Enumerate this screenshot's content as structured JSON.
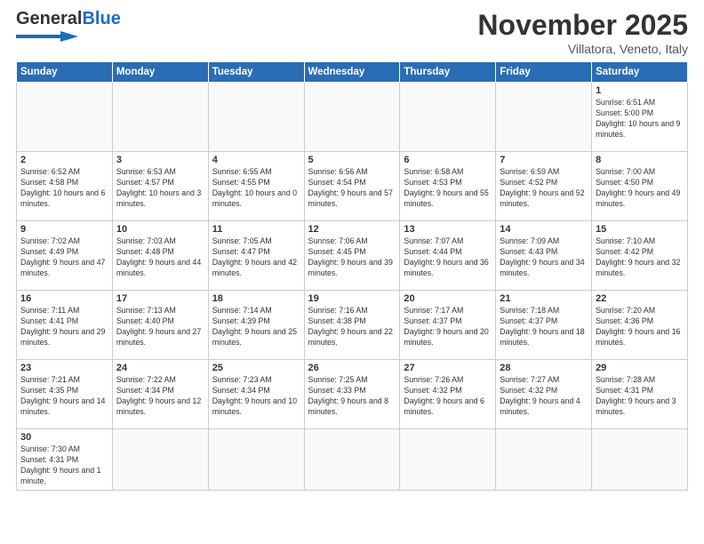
{
  "header": {
    "logo_general": "General",
    "logo_blue": "Blue",
    "month_title": "November 2025",
    "location": "Villatora, Veneto, Italy"
  },
  "days_of_week": [
    "Sunday",
    "Monday",
    "Tuesday",
    "Wednesday",
    "Thursday",
    "Friday",
    "Saturday"
  ],
  "weeks": [
    [
      {
        "day": "",
        "info": ""
      },
      {
        "day": "",
        "info": ""
      },
      {
        "day": "",
        "info": ""
      },
      {
        "day": "",
        "info": ""
      },
      {
        "day": "",
        "info": ""
      },
      {
        "day": "",
        "info": ""
      },
      {
        "day": "1",
        "info": "Sunrise: 6:51 AM\nSunset: 5:00 PM\nDaylight: 10 hours and 9 minutes."
      }
    ],
    [
      {
        "day": "2",
        "info": "Sunrise: 6:52 AM\nSunset: 4:58 PM\nDaylight: 10 hours and 6 minutes."
      },
      {
        "day": "3",
        "info": "Sunrise: 6:53 AM\nSunset: 4:57 PM\nDaylight: 10 hours and 3 minutes."
      },
      {
        "day": "4",
        "info": "Sunrise: 6:55 AM\nSunset: 4:55 PM\nDaylight: 10 hours and 0 minutes."
      },
      {
        "day": "5",
        "info": "Sunrise: 6:56 AM\nSunset: 4:54 PM\nDaylight: 9 hours and 57 minutes."
      },
      {
        "day": "6",
        "info": "Sunrise: 6:58 AM\nSunset: 4:53 PM\nDaylight: 9 hours and 55 minutes."
      },
      {
        "day": "7",
        "info": "Sunrise: 6:59 AM\nSunset: 4:52 PM\nDaylight: 9 hours and 52 minutes."
      },
      {
        "day": "8",
        "info": "Sunrise: 7:00 AM\nSunset: 4:50 PM\nDaylight: 9 hours and 49 minutes."
      }
    ],
    [
      {
        "day": "9",
        "info": "Sunrise: 7:02 AM\nSunset: 4:49 PM\nDaylight: 9 hours and 47 minutes."
      },
      {
        "day": "10",
        "info": "Sunrise: 7:03 AM\nSunset: 4:48 PM\nDaylight: 9 hours and 44 minutes."
      },
      {
        "day": "11",
        "info": "Sunrise: 7:05 AM\nSunset: 4:47 PM\nDaylight: 9 hours and 42 minutes."
      },
      {
        "day": "12",
        "info": "Sunrise: 7:06 AM\nSunset: 4:45 PM\nDaylight: 9 hours and 39 minutes."
      },
      {
        "day": "13",
        "info": "Sunrise: 7:07 AM\nSunset: 4:44 PM\nDaylight: 9 hours and 36 minutes."
      },
      {
        "day": "14",
        "info": "Sunrise: 7:09 AM\nSunset: 4:43 PM\nDaylight: 9 hours and 34 minutes."
      },
      {
        "day": "15",
        "info": "Sunrise: 7:10 AM\nSunset: 4:42 PM\nDaylight: 9 hours and 32 minutes."
      }
    ],
    [
      {
        "day": "16",
        "info": "Sunrise: 7:11 AM\nSunset: 4:41 PM\nDaylight: 9 hours and 29 minutes."
      },
      {
        "day": "17",
        "info": "Sunrise: 7:13 AM\nSunset: 4:40 PM\nDaylight: 9 hours and 27 minutes."
      },
      {
        "day": "18",
        "info": "Sunrise: 7:14 AM\nSunset: 4:39 PM\nDaylight: 9 hours and 25 minutes."
      },
      {
        "day": "19",
        "info": "Sunrise: 7:16 AM\nSunset: 4:38 PM\nDaylight: 9 hours and 22 minutes."
      },
      {
        "day": "20",
        "info": "Sunrise: 7:17 AM\nSunset: 4:37 PM\nDaylight: 9 hours and 20 minutes."
      },
      {
        "day": "21",
        "info": "Sunrise: 7:18 AM\nSunset: 4:37 PM\nDaylight: 9 hours and 18 minutes."
      },
      {
        "day": "22",
        "info": "Sunrise: 7:20 AM\nSunset: 4:36 PM\nDaylight: 9 hours and 16 minutes."
      }
    ],
    [
      {
        "day": "23",
        "info": "Sunrise: 7:21 AM\nSunset: 4:35 PM\nDaylight: 9 hours and 14 minutes."
      },
      {
        "day": "24",
        "info": "Sunrise: 7:22 AM\nSunset: 4:34 PM\nDaylight: 9 hours and 12 minutes."
      },
      {
        "day": "25",
        "info": "Sunrise: 7:23 AM\nSunset: 4:34 PM\nDaylight: 9 hours and 10 minutes."
      },
      {
        "day": "26",
        "info": "Sunrise: 7:25 AM\nSunset: 4:33 PM\nDaylight: 9 hours and 8 minutes."
      },
      {
        "day": "27",
        "info": "Sunrise: 7:26 AM\nSunset: 4:32 PM\nDaylight: 9 hours and 6 minutes."
      },
      {
        "day": "28",
        "info": "Sunrise: 7:27 AM\nSunset: 4:32 PM\nDaylight: 9 hours and 4 minutes."
      },
      {
        "day": "29",
        "info": "Sunrise: 7:28 AM\nSunset: 4:31 PM\nDaylight: 9 hours and 3 minutes."
      }
    ],
    [
      {
        "day": "30",
        "info": "Sunrise: 7:30 AM\nSunset: 4:31 PM\nDaylight: 9 hours and 1 minute."
      },
      {
        "day": "",
        "info": ""
      },
      {
        "day": "",
        "info": ""
      },
      {
        "day": "",
        "info": ""
      },
      {
        "day": "",
        "info": ""
      },
      {
        "day": "",
        "info": ""
      },
      {
        "day": "",
        "info": ""
      }
    ]
  ]
}
